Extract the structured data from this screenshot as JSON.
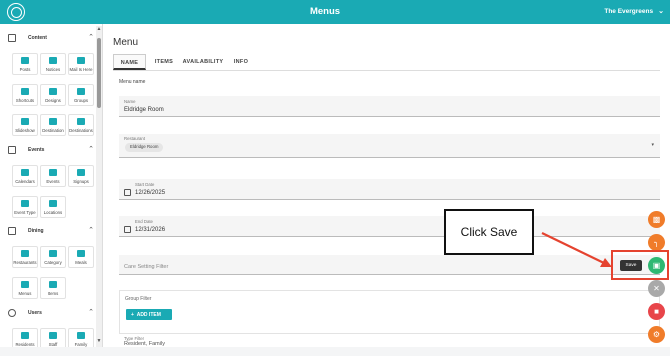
{
  "header": {
    "title": "Menus",
    "organization": "The Evergreens",
    "logo_icon": "app-logo-icon",
    "chevron_icon": "chevron-down-icon"
  },
  "sidebar": {
    "sections": [
      {
        "title": "Content",
        "items": [
          {
            "label": "Posts"
          },
          {
            "label": "Notices"
          },
          {
            "label": "Mail Is Here"
          },
          {
            "label": "Shortcuts"
          },
          {
            "label": "Designs"
          },
          {
            "label": "Groups"
          },
          {
            "label": "Slideshow"
          },
          {
            "label": "Destination"
          },
          {
            "label": "Destinations"
          }
        ]
      },
      {
        "title": "Events",
        "items": [
          {
            "label": "Calendars"
          },
          {
            "label": "Events"
          },
          {
            "label": "Signups"
          },
          {
            "label": "Event Type"
          },
          {
            "label": "Locations"
          }
        ]
      },
      {
        "title": "Dining",
        "items": [
          {
            "label": "Restaurants"
          },
          {
            "label": "Category"
          },
          {
            "label": "Meals"
          },
          {
            "label": "Menus"
          },
          {
            "label": "Items"
          }
        ]
      },
      {
        "title": "Users",
        "items": [
          {
            "label": "Residents"
          },
          {
            "label": "Staff"
          },
          {
            "label": "Family"
          }
        ]
      }
    ]
  },
  "main": {
    "page_title": "Menu",
    "tabs": [
      {
        "label": "NAME",
        "active": true
      },
      {
        "label": "ITEMS",
        "active": false
      },
      {
        "label": "AVAILABILITY",
        "active": false
      },
      {
        "label": "INFO",
        "active": false
      }
    ],
    "section_label": "Menu name",
    "name_field": {
      "label": "Name",
      "value": "Eldridge Room"
    },
    "restaurant_field": {
      "label": "Restaurant",
      "chip": "Eldridge Room"
    },
    "start_date_field": {
      "label": "Start Date",
      "value": "12/26/2025"
    },
    "end_date_field": {
      "label": "End Date",
      "value": "12/31/2026"
    },
    "care_setting_field": {
      "placeholder": "Care Setting Filter"
    },
    "group_filter": {
      "label": "Group Filter",
      "button_label": "ADD ITEM"
    },
    "type_filter": {
      "label": "Type Filter",
      "value": "Resident, Family"
    }
  },
  "actions": {
    "save_tooltip": "Save",
    "buttons": [
      {
        "name": "preview-button",
        "icon": "calendar-preview-icon",
        "color": "#f07c2a"
      },
      {
        "name": "dining-button",
        "icon": "chair-icon",
        "color": "#f07c2a"
      },
      {
        "name": "save-button",
        "icon": "save-icon",
        "color": "#2eb872"
      },
      {
        "name": "disabled-tool-button",
        "icon": "tools-icon",
        "color": "#a9a9a9"
      },
      {
        "name": "delete-button",
        "icon": "trash-icon",
        "color": "#e8454a"
      },
      {
        "name": "settings-button",
        "icon": "gear-icon",
        "color": "#f07c2a"
      }
    ]
  },
  "annotation": {
    "callout_text": "Click Save",
    "highlight_color": "#e5432f"
  },
  "colors": {
    "brand_teal": "#1aaab4",
    "accent_orange": "#f07c2a",
    "save_green": "#2eb872",
    "delete_red": "#e8454a"
  }
}
